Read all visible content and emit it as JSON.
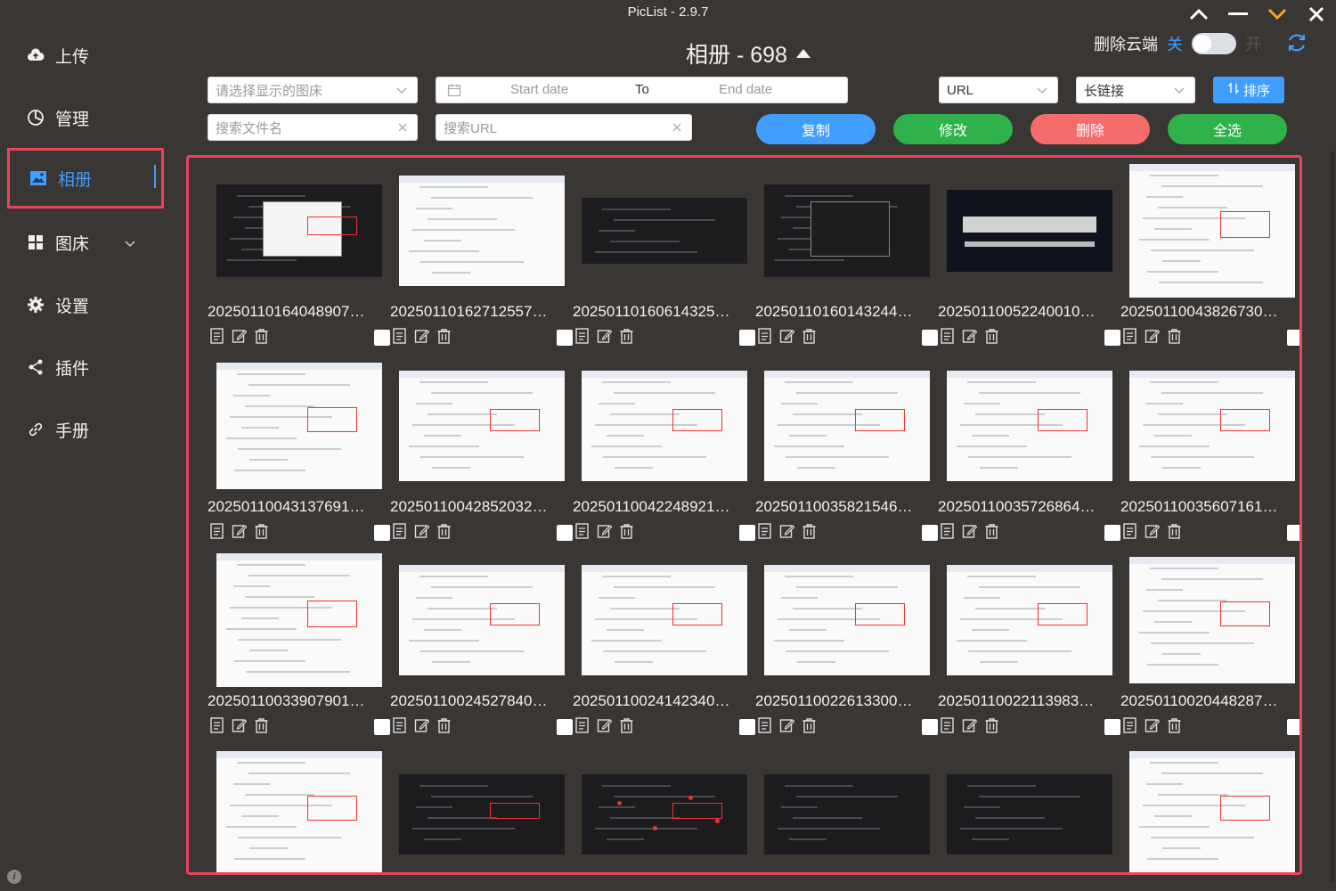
{
  "app_title": "PicList - 2.9.7",
  "window_controls": [
    "chevron-up",
    "minimize",
    "chevron-down",
    "close"
  ],
  "sidebar": {
    "items": [
      {
        "label": "上传",
        "icon": "cloud-upload-icon"
      },
      {
        "label": "管理",
        "icon": "pie-chart-icon"
      },
      {
        "label": "相册",
        "icon": "image-icon",
        "active": true
      },
      {
        "label": "图床",
        "icon": "grid-icon",
        "expandable": true
      },
      {
        "label": "设置",
        "icon": "gear-icon"
      },
      {
        "label": "插件",
        "icon": "share-icon"
      },
      {
        "label": "手册",
        "icon": "link-icon"
      }
    ]
  },
  "header": {
    "title": "相册 - 698",
    "delete_cloud_label": "删除云端",
    "toggle_off_label": "关",
    "toggle_on_label": "开",
    "toggle_state": false
  },
  "filters": {
    "bed_placeholder": "请选择显示的图床",
    "start_date_placeholder": "Start date",
    "date_separator": "To",
    "end_date_placeholder": "End date",
    "url_type": "URL",
    "link_type": "长链接",
    "sort_label": "排序",
    "search_filename_placeholder": "搜索文件名",
    "search_url_placeholder": "搜索URL"
  },
  "actions": {
    "copy": "复制",
    "edit": "修改",
    "delete": "删除",
    "select_all": "全选"
  },
  "colors": {
    "accent": "#409eff",
    "copy": "#409eff",
    "edit": "#2fb24b",
    "delete": "#f56c6c",
    "select_all": "#2fb24b",
    "highlight_border": "#e9455a"
  },
  "gallery": [
    {
      "name": "20250110164048907",
      "thumb": "dark-dialog"
    },
    {
      "name": "20250110162712557",
      "thumb": "doc"
    },
    {
      "name": "20250110160614325",
      "thumb": "dark-split"
    },
    {
      "name": "20250110160143244",
      "thumb": "dark-upload"
    },
    {
      "name": "20250110052240010",
      "thumb": "banner"
    },
    {
      "name": "20250110043826730",
      "thumb": "table"
    },
    {
      "name": "20250110043137691",
      "thumb": "form"
    },
    {
      "name": "20250110042852032",
      "thumb": "light-panel"
    },
    {
      "name": "20250110042248921",
      "thumb": "light-cards"
    },
    {
      "name": "20250110035821546",
      "thumb": "light-list"
    },
    {
      "name": "20250110035726864",
      "thumb": "light-grid"
    },
    {
      "name": "20250110035607161",
      "thumb": "light-grid"
    },
    {
      "name": "20250110033907901",
      "thumb": "table"
    },
    {
      "name": "20250110024527840",
      "thumb": "light-panel"
    },
    {
      "name": "20250110024142340",
      "thumb": "light-panel"
    },
    {
      "name": "20250110022613300",
      "thumb": "light-list"
    },
    {
      "name": "20250110022113983",
      "thumb": "light-list"
    },
    {
      "name": "20250110020448287",
      "thumb": "form"
    },
    {
      "name": "",
      "thumb": "form"
    },
    {
      "name": "",
      "thumb": "dark-menu"
    },
    {
      "name": "",
      "thumb": "dark-graph"
    },
    {
      "name": "",
      "thumb": "dark-empty"
    },
    {
      "name": "",
      "thumb": "dark-empty"
    },
    {
      "name": "",
      "thumb": "form"
    }
  ]
}
